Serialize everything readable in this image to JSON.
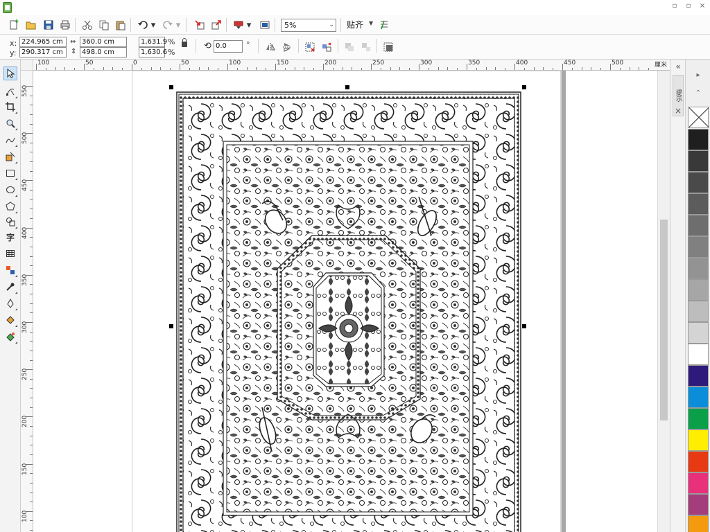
{
  "window": {
    "minimize": "▫",
    "restore": "▫",
    "close": "×"
  },
  "standard_toolbar": {
    "zoom_value": "5%",
    "snap_label": "贴齐"
  },
  "property_bar": {
    "x_label": "x:",
    "x_value": "224.965 cm",
    "y_label": "y:",
    "y_value": "290.317 cm",
    "width_value": "360.0 cm",
    "height_value": "498.0 cm",
    "scale_x_value": "1,631.9",
    "scale_y_value": "1,630.6",
    "percent_1": "%",
    "percent_2": "%",
    "rotation_value": "0.0",
    "degree_symbol": "°"
  },
  "ruler": {
    "unit": "厘米",
    "h_labels": [
      "100",
      "50",
      "0",
      "50",
      "100",
      "150",
      "200",
      "250",
      "300",
      "350",
      "400",
      "450",
      "500"
    ],
    "v_labels": [
      "550",
      "500",
      "450",
      "400",
      "350",
      "300",
      "250",
      "200",
      "150",
      "100"
    ]
  },
  "docker": {
    "tab_label": "提示"
  },
  "palette": {
    "colors": [
      "#1f1f1f",
      "#393939",
      "#4a4a4a",
      "#5c5c5c",
      "#6e6e6e",
      "#808080",
      "#939393",
      "#a6a6a6",
      "#bdbdbd",
      "#d4d4d4",
      "#ffffff",
      "#2e1a7a",
      "#0a8ed9",
      "#0aa04a",
      "#ffee00",
      "#e83a12",
      "#e8317a",
      "#a33d7c",
      "#f39a0e"
    ]
  }
}
